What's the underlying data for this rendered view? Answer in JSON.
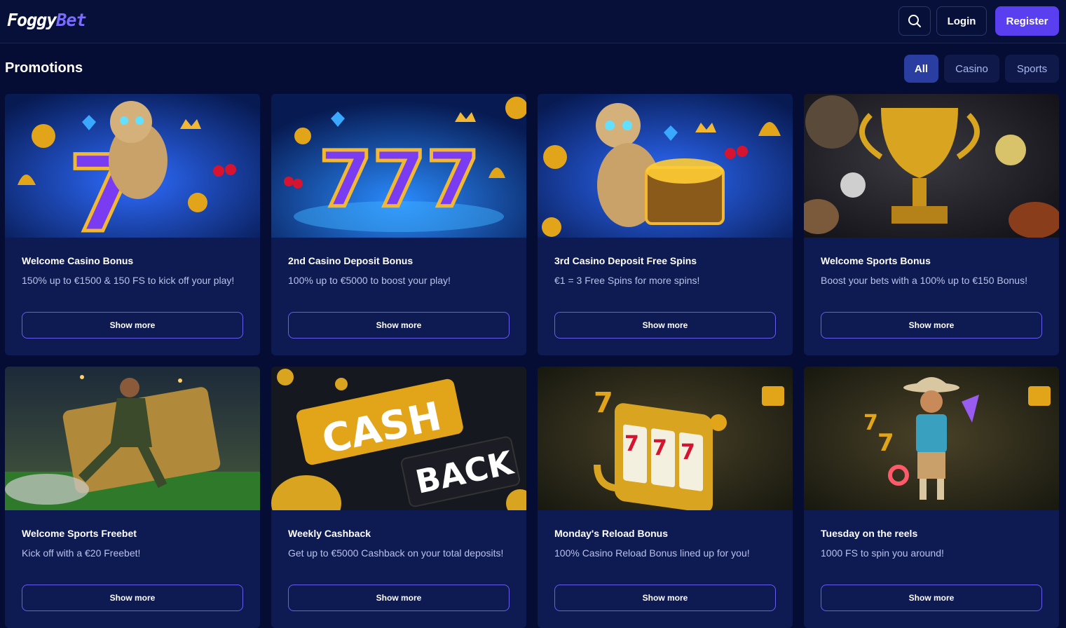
{
  "header": {
    "logo": {
      "part1": "Foggy",
      "part2": "Bet"
    },
    "search_icon": "search-icon",
    "login_label": "Login",
    "register_label": "Register"
  },
  "page": {
    "title": "Promotions"
  },
  "filters": [
    {
      "label": "All",
      "active": true
    },
    {
      "label": "Casino",
      "active": false
    },
    {
      "label": "Sports",
      "active": false
    }
  ],
  "promotions": [
    {
      "title": "Welcome Casino Bonus",
      "description": "150% up to €1500 & 150 FS to kick off your play!",
      "cta": "Show more",
      "image": "mummy-slot-seven"
    },
    {
      "title": "2nd Casino Deposit Bonus",
      "description": "100% up to €5000 to boost your play!",
      "cta": "Show more",
      "image": "triple-seven"
    },
    {
      "title": "3rd Casino Deposit Free Spins",
      "description": "€1 = 3 Free Spins for more spins!",
      "cta": "Show more",
      "image": "mummy-treasure-chest"
    },
    {
      "title": "Welcome Sports Bonus",
      "description": "Boost your bets with a 100% up to €150 Bonus!",
      "cta": "Show more",
      "image": "golden-trophy"
    },
    {
      "title": "Welcome Sports Freebet",
      "description": "Kick off with a €20 Freebet!",
      "cta": "Show more",
      "image": "football-player-ticket"
    },
    {
      "title": "Weekly Cashback",
      "description": "Get up to €5000 Cashback on your total deposits!",
      "cta": "Show more",
      "image": "cash-back-banner"
    },
    {
      "title": "Monday's Reload Bonus",
      "description": "100% Casino Reload Bonus lined up for you!",
      "cta": "Show more",
      "image": "slot-machine"
    },
    {
      "title": "Tuesday on the reels",
      "description": "1000 FS to spin you around!",
      "cta": "Show more",
      "image": "cowboy-character"
    }
  ],
  "image_text": {
    "cash": "CASH",
    "back": "BACK",
    "seven": "7",
    "sevens": "777"
  },
  "colors": {
    "background": "#060d35",
    "card": "#0e1a52",
    "accent": "#5a3ff0",
    "outline": "#6a5cf0"
  }
}
